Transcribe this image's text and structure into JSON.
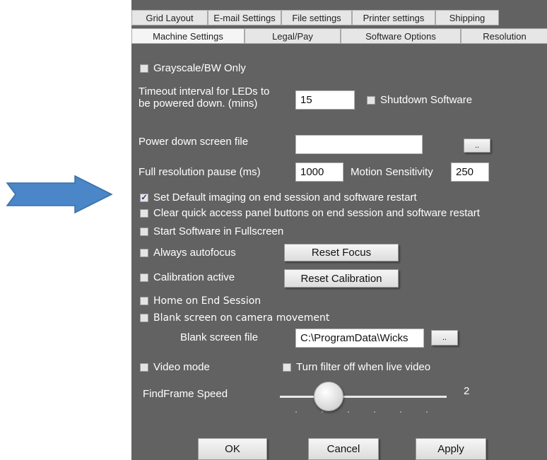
{
  "tabs_row1": [
    "Grid Layout",
    "E-mail Settings",
    "File settings",
    "Printer settings",
    "Shipping"
  ],
  "tabs_row2": [
    "Machine Settings",
    "Legal/Pay",
    "Software Options",
    "Resolution"
  ],
  "active_tab": "Machine Settings",
  "settings": {
    "grayscale": {
      "label": "Grayscale/BW Only",
      "checked": false
    },
    "timeout_label_1": "Timeout interval for LEDs to",
    "timeout_label_2": "be powered down. (mins)",
    "timeout_value": "15",
    "shutdown": {
      "label": "Shutdown Software",
      "checked": false
    },
    "power_down_label": "Power down screen file",
    "power_down_value": "",
    "browse_label": "..",
    "full_res_label": "Full resolution pause (ms)",
    "full_res_value": "1000",
    "motion_label": "Motion Sensitivity",
    "motion_value": "250",
    "default_imaging": {
      "label": "Set Default imaging on end session and software restart",
      "checked": true
    },
    "clear_quick": {
      "label": "Clear quick access panel buttons on end session and software restart",
      "checked": false
    },
    "fullscreen": {
      "label": "Start Software in Fullscreen",
      "checked": false
    },
    "autofocus": {
      "label": "Always autofocus",
      "checked": false
    },
    "reset_focus_label": "Reset Focus",
    "calibration": {
      "label": "Calibration active",
      "checked": false
    },
    "reset_calibration_label": "Reset Calibration",
    "home_end": {
      "label": "Home on End Session",
      "checked": false
    },
    "blank_screen": {
      "label": "Blank screen on camera movement",
      "checked": false
    },
    "blank_file_label": "Blank screen file",
    "blank_file_value": "C:\\ProgramData\\Wicks",
    "blank_browse_label": "..",
    "video_mode": {
      "label": "Video mode",
      "checked": false
    },
    "turn_filter": {
      "label": "Turn filter off when live video",
      "checked": false
    },
    "findframe_label": "FindFrame Speed",
    "findframe_value": "2",
    "findframe_level": 0.2
  },
  "buttons": {
    "ok": "OK",
    "cancel": "Cancel",
    "apply": "Apply"
  },
  "colors": {
    "panel": "#626262",
    "arrow": "#4a86c8"
  }
}
